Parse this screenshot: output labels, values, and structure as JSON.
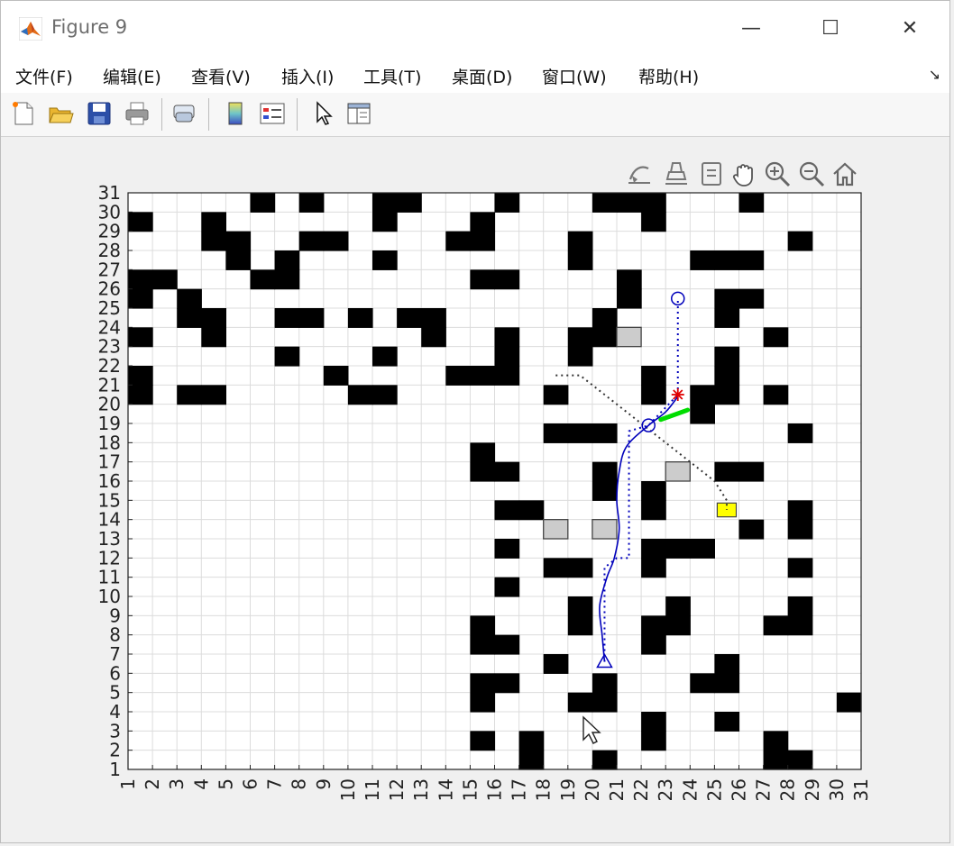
{
  "window": {
    "title": "Figure 9"
  },
  "window_controls": {
    "minimize": "—",
    "maximize": "☐",
    "close": "✕"
  },
  "menu": [
    {
      "label": "文件(F)"
    },
    {
      "label": "编辑(E)"
    },
    {
      "label": "查看(V)"
    },
    {
      "label": "插入(I)"
    },
    {
      "label": "工具(T)"
    },
    {
      "label": "桌面(D)"
    },
    {
      "label": "窗口(W)"
    },
    {
      "label": "帮助(H)"
    }
  ],
  "menu_overflow": "↘",
  "toolbar": [
    "new-figure-icon",
    "open-file-icon",
    "save-icon",
    "print-icon",
    "link-plot-icon",
    "colorbar-icon",
    "legend-icon",
    "edit-plot-arrow-icon",
    "property-inspector-icon"
  ],
  "axes_toolbar": [
    "brush-icon",
    "data-tips-icon",
    "datatip-icon",
    "pan-hand-icon",
    "zoom-in-icon",
    "zoom-out-icon",
    "home-icon"
  ],
  "colors": {
    "obstacle": "#000000",
    "dynamic_obstacle": "#cccccc",
    "goal": "#ffff00",
    "path": "#0000bb",
    "start_marker": "#e00000",
    "heading": "#00dd00"
  },
  "chart_data": {
    "type": "grid",
    "xlim": [
      1,
      31
    ],
    "ylim": [
      1,
      31
    ],
    "x_ticks": [
      1,
      2,
      3,
      4,
      5,
      6,
      7,
      8,
      9,
      10,
      11,
      12,
      13,
      14,
      15,
      16,
      17,
      18,
      19,
      20,
      21,
      22,
      23,
      24,
      25,
      26,
      27,
      28,
      29,
      30,
      31
    ],
    "y_ticks": [
      1,
      2,
      3,
      4,
      5,
      6,
      7,
      8,
      9,
      10,
      11,
      12,
      13,
      14,
      15,
      16,
      17,
      18,
      19,
      20,
      21,
      22,
      23,
      24,
      25,
      26,
      27,
      28,
      29,
      30,
      31
    ],
    "grid": true,
    "obstacles": [
      [
        6,
        30
      ],
      [
        8,
        30
      ],
      [
        11,
        30
      ],
      [
        12,
        30
      ],
      [
        16,
        30
      ],
      [
        20,
        30
      ],
      [
        21,
        30
      ],
      [
        22,
        30
      ],
      [
        26,
        30
      ],
      [
        1,
        29
      ],
      [
        4,
        29
      ],
      [
        11,
        29
      ],
      [
        15,
        29
      ],
      [
        22,
        29
      ],
      [
        4,
        28
      ],
      [
        5,
        28
      ],
      [
        8,
        28
      ],
      [
        9,
        28
      ],
      [
        14,
        28
      ],
      [
        15,
        28
      ],
      [
        19,
        28
      ],
      [
        28,
        28
      ],
      [
        5,
        27
      ],
      [
        7,
        27
      ],
      [
        11,
        27
      ],
      [
        19,
        27
      ],
      [
        24,
        27
      ],
      [
        25,
        27
      ],
      [
        26,
        27
      ],
      [
        1,
        26
      ],
      [
        2,
        26
      ],
      [
        6,
        26
      ],
      [
        7,
        26
      ],
      [
        15,
        26
      ],
      [
        16,
        26
      ],
      [
        21,
        26
      ],
      [
        1,
        25
      ],
      [
        3,
        25
      ],
      [
        21,
        25
      ],
      [
        25,
        25
      ],
      [
        26,
        25
      ],
      [
        3,
        24
      ],
      [
        4,
        24
      ],
      [
        7,
        24
      ],
      [
        8,
        24
      ],
      [
        10,
        24
      ],
      [
        12,
        24
      ],
      [
        13,
        24
      ],
      [
        20,
        24
      ],
      [
        25,
        24
      ],
      [
        1,
        23
      ],
      [
        4,
        23
      ],
      [
        13,
        23
      ],
      [
        16,
        23
      ],
      [
        19,
        23
      ],
      [
        20,
        23
      ],
      [
        27,
        23
      ],
      [
        7,
        22
      ],
      [
        11,
        22
      ],
      [
        16,
        22
      ],
      [
        19,
        22
      ],
      [
        25,
        22
      ],
      [
        1,
        21
      ],
      [
        9,
        21
      ],
      [
        14,
        21
      ],
      [
        15,
        21
      ],
      [
        16,
        21
      ],
      [
        22,
        21
      ],
      [
        25,
        21
      ],
      [
        1,
        20
      ],
      [
        3,
        20
      ],
      [
        4,
        20
      ],
      [
        10,
        20
      ],
      [
        11,
        20
      ],
      [
        18,
        20
      ],
      [
        22,
        20
      ],
      [
        24,
        20
      ],
      [
        25,
        20
      ],
      [
        27,
        20
      ],
      [
        24,
        19
      ],
      [
        18,
        18
      ],
      [
        19,
        18
      ],
      [
        20,
        18
      ],
      [
        28,
        18
      ],
      [
        15,
        17
      ],
      [
        15,
        16
      ],
      [
        16,
        16
      ],
      [
        20,
        16
      ],
      [
        25,
        16
      ],
      [
        26,
        16
      ],
      [
        20,
        15
      ],
      [
        22,
        15
      ],
      [
        16,
        14
      ],
      [
        17,
        14
      ],
      [
        22,
        14
      ],
      [
        28,
        14
      ],
      [
        26,
        13
      ],
      [
        28,
        13
      ],
      [
        16,
        12
      ],
      [
        22,
        12
      ],
      [
        23,
        12
      ],
      [
        24,
        12
      ],
      [
        18,
        11
      ],
      [
        19,
        11
      ],
      [
        22,
        11
      ],
      [
        28,
        11
      ],
      [
        16,
        10
      ],
      [
        19,
        9
      ],
      [
        23,
        9
      ],
      [
        28,
        9
      ],
      [
        15,
        8
      ],
      [
        19,
        8
      ],
      [
        22,
        8
      ],
      [
        23,
        8
      ],
      [
        27,
        8
      ],
      [
        28,
        8
      ],
      [
        15,
        7
      ],
      [
        16,
        7
      ],
      [
        22,
        7
      ],
      [
        18,
        6
      ],
      [
        25,
        6
      ],
      [
        15,
        5
      ],
      [
        16,
        5
      ],
      [
        20,
        5
      ],
      [
        24,
        5
      ],
      [
        25,
        5
      ],
      [
        15,
        4
      ],
      [
        19,
        4
      ],
      [
        20,
        4
      ],
      [
        30,
        4
      ],
      [
        22,
        3
      ],
      [
        25,
        3
      ],
      [
        15,
        2
      ],
      [
        17,
        2
      ],
      [
        22,
        2
      ],
      [
        27,
        2
      ],
      [
        17,
        1
      ],
      [
        20,
        1
      ],
      [
        27,
        1
      ],
      [
        28,
        1
      ]
    ],
    "dynamic_obstacles": [
      [
        21,
        23
      ],
      [
        23,
        16
      ],
      [
        18,
        13
      ],
      [
        20,
        13
      ]
    ],
    "goal_cell": [
      25,
      14
    ],
    "start": [
      20.5,
      6.6
    ],
    "circle_start": [
      23.5,
      25.5
    ],
    "red_star": [
      23.5,
      20.5
    ],
    "current_position": [
      22.3,
      18.9
    ],
    "heading": {
      "from": [
        22.8,
        19.2
      ],
      "to": [
        23.9,
        19.7
      ]
    },
    "path_smooth": [
      [
        20.5,
        6.6
      ],
      [
        20.4,
        8
      ],
      [
        20.3,
        9.5
      ],
      [
        20.6,
        11
      ],
      [
        20.9,
        12
      ],
      [
        21.1,
        13.5
      ],
      [
        21.0,
        15
      ],
      [
        21.1,
        16.5
      ],
      [
        21.4,
        17.8
      ],
      [
        22.3,
        18.9
      ],
      [
        23.0,
        19.6
      ],
      [
        23.5,
        20.4
      ]
    ],
    "path_dotted_blue_1": [
      [
        20.5,
        6.6
      ],
      [
        20.5,
        11.5
      ],
      [
        21,
        12
      ],
      [
        21.5,
        12
      ],
      [
        21.5,
        18.6
      ],
      [
        22.3,
        18.9
      ],
      [
        23.5,
        20.5
      ]
    ],
    "path_dotted_blue_2": [
      [
        23.5,
        20.5
      ],
      [
        23.5,
        25.5
      ]
    ],
    "path_dotted_black": [
      [
        18.5,
        21.5
      ],
      [
        19.5,
        21.5
      ],
      [
        20,
        21
      ],
      [
        21,
        20
      ],
      [
        22,
        19
      ],
      [
        23,
        18
      ],
      [
        24,
        17
      ],
      [
        25,
        16
      ],
      [
        25.5,
        15
      ],
      [
        25.5,
        14.5
      ]
    ]
  }
}
